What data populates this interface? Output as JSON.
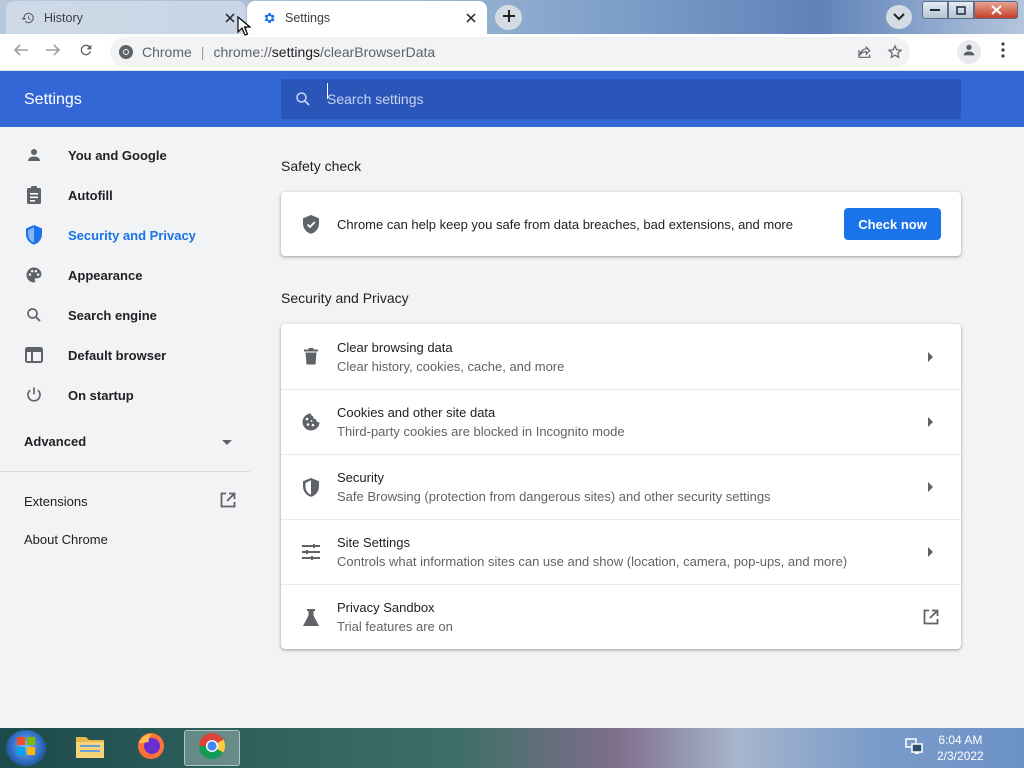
{
  "tabs": [
    {
      "title": "History",
      "icon": "history-icon"
    },
    {
      "title": "Settings",
      "icon": "gear-icon"
    }
  ],
  "omnibox": {
    "site_label": "Chrome",
    "url_prefix": "chrome://",
    "url_host": "settings",
    "url_path": "/clearBrowserData"
  },
  "header": {
    "title": "Settings",
    "search_placeholder": "Search settings"
  },
  "sidebar": {
    "items": [
      {
        "label": "You and Google",
        "icon": "person-icon"
      },
      {
        "label": "Autofill",
        "icon": "clipboard-icon"
      },
      {
        "label": "Security and Privacy",
        "icon": "shield-icon"
      },
      {
        "label": "Appearance",
        "icon": "palette-icon"
      },
      {
        "label": "Search engine",
        "icon": "search-icon"
      },
      {
        "label": "Default browser",
        "icon": "browser-icon"
      },
      {
        "label": "On startup",
        "icon": "power-icon"
      }
    ],
    "advanced_label": "Advanced",
    "extensions_label": "Extensions",
    "about_label": "About Chrome"
  },
  "safety_check": {
    "section_title": "Safety check",
    "text": "Chrome can help keep you safe from data breaches, bad extensions, and more",
    "button_label": "Check now"
  },
  "security_privacy": {
    "section_title": "Security and Privacy",
    "rows": [
      {
        "title": "Clear browsing data",
        "subtitle": "Clear history, cookies, cache, and more",
        "icon": "trash-icon"
      },
      {
        "title": "Cookies and other site data",
        "subtitle": "Third-party cookies are blocked in Incognito mode",
        "icon": "cookie-icon"
      },
      {
        "title": "Security",
        "subtitle": "Safe Browsing (protection from dangerous sites) and other security settings",
        "icon": "shield-icon"
      },
      {
        "title": "Site Settings",
        "subtitle": "Controls what information sites can use and show (location, camera, pop-ups, and more)",
        "icon": "tune-icon"
      },
      {
        "title": "Privacy Sandbox",
        "subtitle": "Trial features are on",
        "icon": "flask-icon"
      }
    ]
  },
  "taskbar": {
    "time": "6:04 AM",
    "date": "2/3/2022"
  },
  "colors": {
    "accent": "#1a73e8",
    "header_bg": "#3367d6",
    "page_bg": "#f1f3f4"
  }
}
